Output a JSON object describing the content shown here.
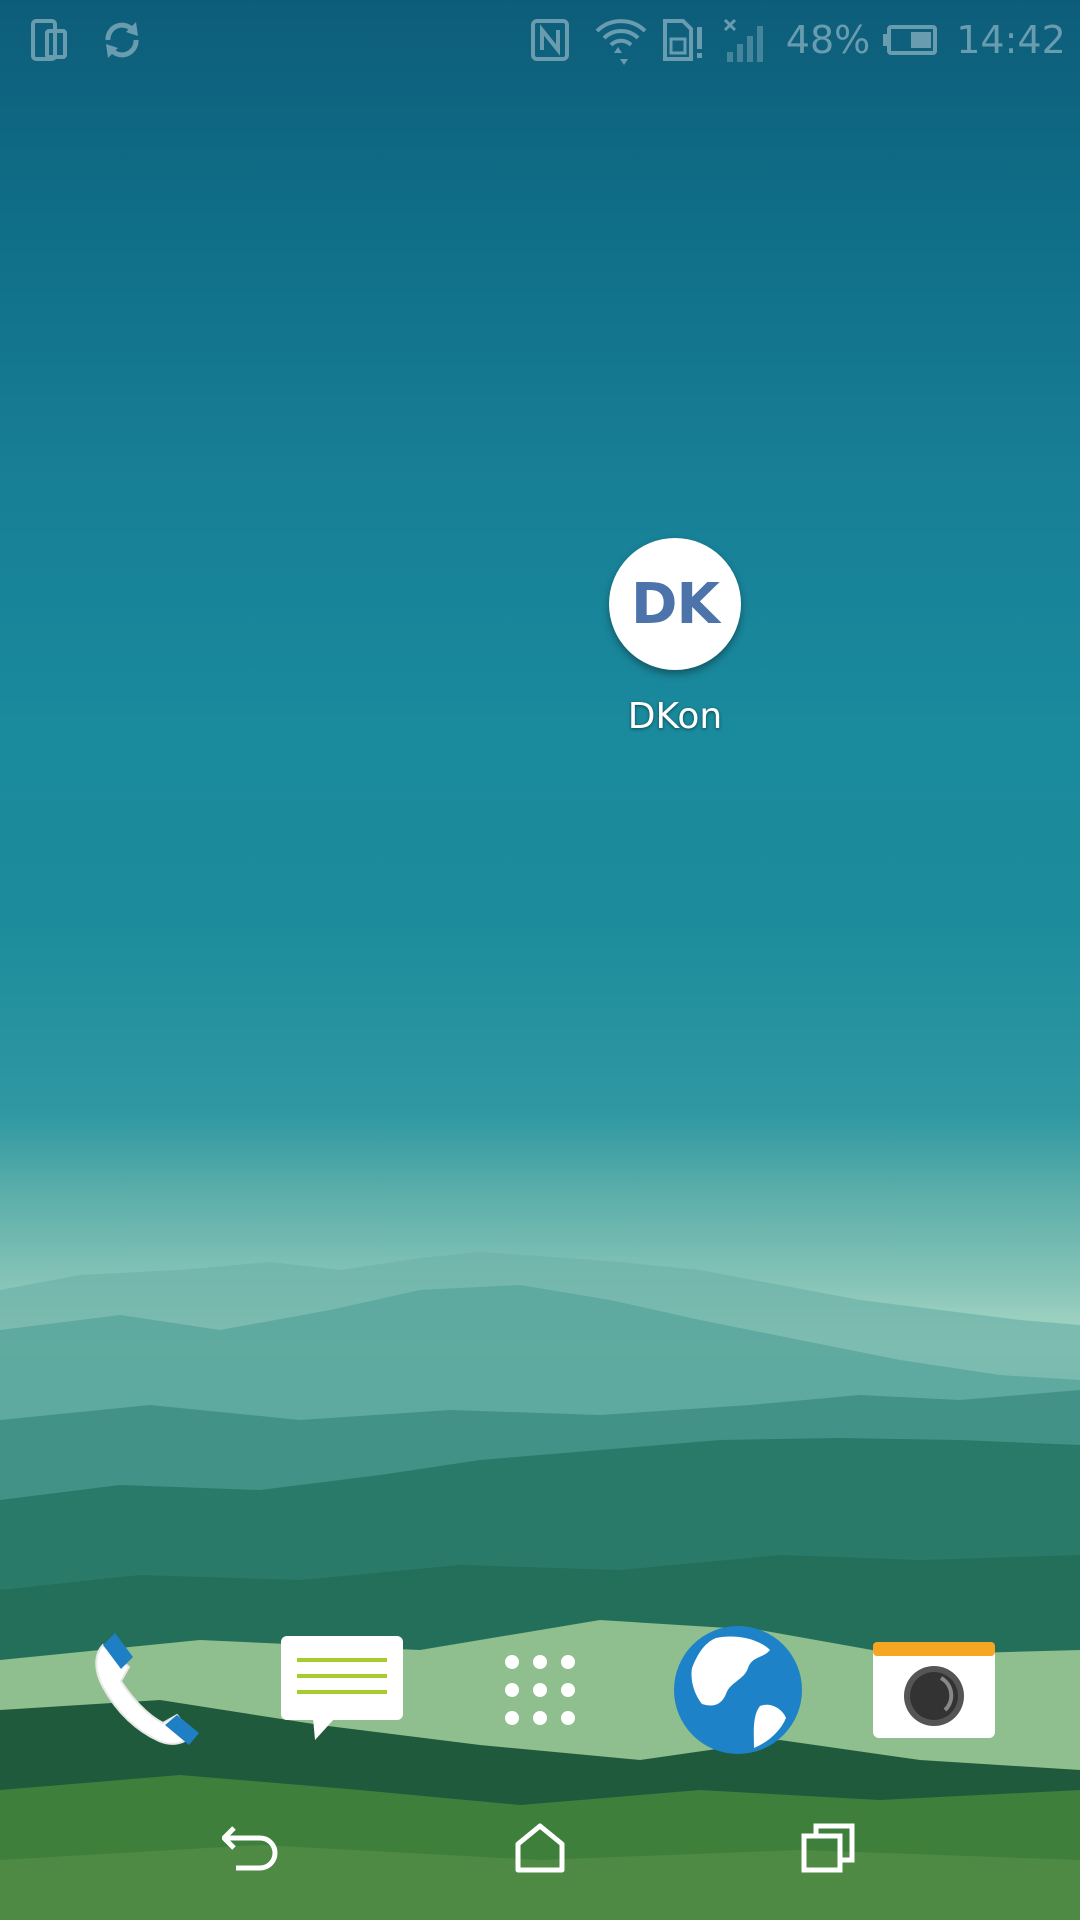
{
  "status_bar": {
    "battery_percent": "48%",
    "time": "14:42",
    "icons": [
      "screen-rotate-icon",
      "sync-icon",
      "nfc-icon",
      "wifi-icon",
      "sim-alert-icon",
      "signal-no-service-icon",
      "battery-icon"
    ]
  },
  "home": {
    "apps": [
      {
        "label": "DKon",
        "icon_text": "DK",
        "icon_color": "#4d73ab"
      }
    ]
  },
  "dock": {
    "items": [
      "phone-icon",
      "messages-icon",
      "app-drawer-icon",
      "browser-icon",
      "camera-icon"
    ]
  },
  "nav_bar": {
    "items": [
      "back-icon",
      "home-icon",
      "recents-icon"
    ]
  },
  "colors": {
    "status_icon": "#6a9cb0",
    "browser_blue": "#1e82c8",
    "camera_top": "#f5a623",
    "message_lines": "#a6cc2e",
    "phone_accent": "#1f7fc4"
  }
}
